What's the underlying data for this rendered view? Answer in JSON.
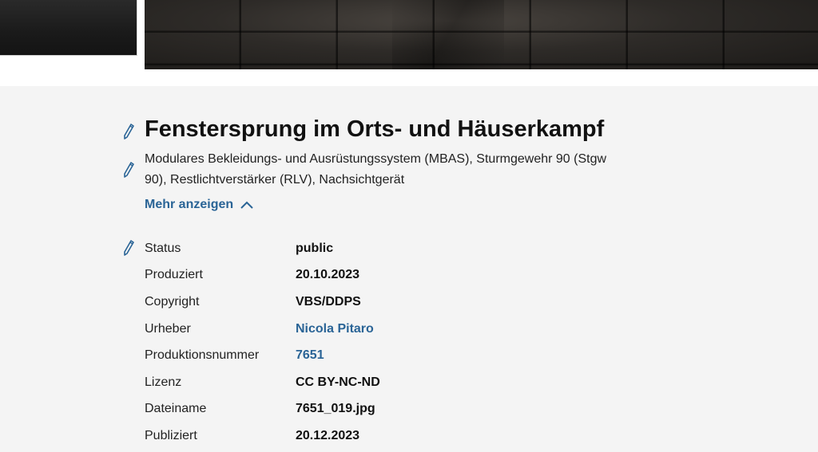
{
  "header": {
    "thumbnail_icon": "image-thumbnail",
    "hero_icon": "stone-wall-photo"
  },
  "asset": {
    "title": "Fenstersprung im Orts- und Häuserkampf",
    "keywords": "Modulares Bekleidungs- und Ausrüstungssystem (MBAS), Sturmgewehr 90 (Stgw 90), Restlichtverstärker (RLV), Nachsichtgerät",
    "more_label": "Mehr anzeigen",
    "edit_icon": "pencil-icon"
  },
  "metadata": [
    {
      "key": "Status",
      "value": "public",
      "link": false
    },
    {
      "key": "Produziert",
      "value": "20.10.2023",
      "link": false
    },
    {
      "key": "Copyright",
      "value": "VBS/DDPS",
      "link": false
    },
    {
      "key": "Urheber",
      "value": "Nicola Pitaro",
      "link": true
    },
    {
      "key": "Produktionsnummer",
      "value": "7651",
      "link": true
    },
    {
      "key": "Lizenz",
      "value": "CC BY-NC-ND",
      "link": false
    },
    {
      "key": "Dateiname",
      "value": "7651_019.jpg",
      "link": false
    },
    {
      "key": "Publiziert",
      "value": "20.12.2023",
      "link": false
    }
  ],
  "colors": {
    "link": "#2a6496",
    "background": "#f4f4f4",
    "pencil": "#2a6496"
  }
}
